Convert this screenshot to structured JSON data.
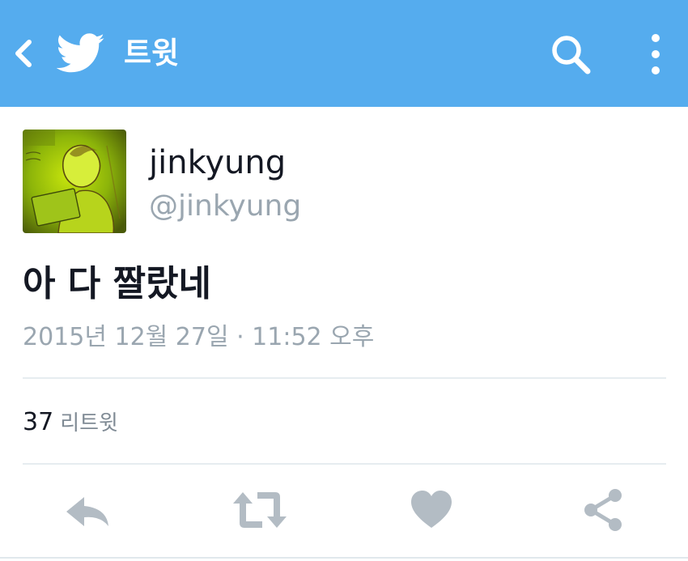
{
  "header": {
    "title": "트윗",
    "icons": [
      "back-icon",
      "twitter-bird-icon",
      "search-icon",
      "more-vertical-icon"
    ],
    "color": "#55acee"
  },
  "tweet": {
    "display_name": "jinkyung",
    "handle": "@jinkyung",
    "text": "아 다 짤랐네",
    "timestamp": "2015년 12월 27일 · 11:52 오후",
    "retweet_count": "37",
    "retweet_label": "리트윗"
  },
  "actions": {
    "icons": [
      "reply-icon",
      "retweet-icon",
      "like-icon",
      "share-icon"
    ],
    "color": "#b3bcc4"
  }
}
